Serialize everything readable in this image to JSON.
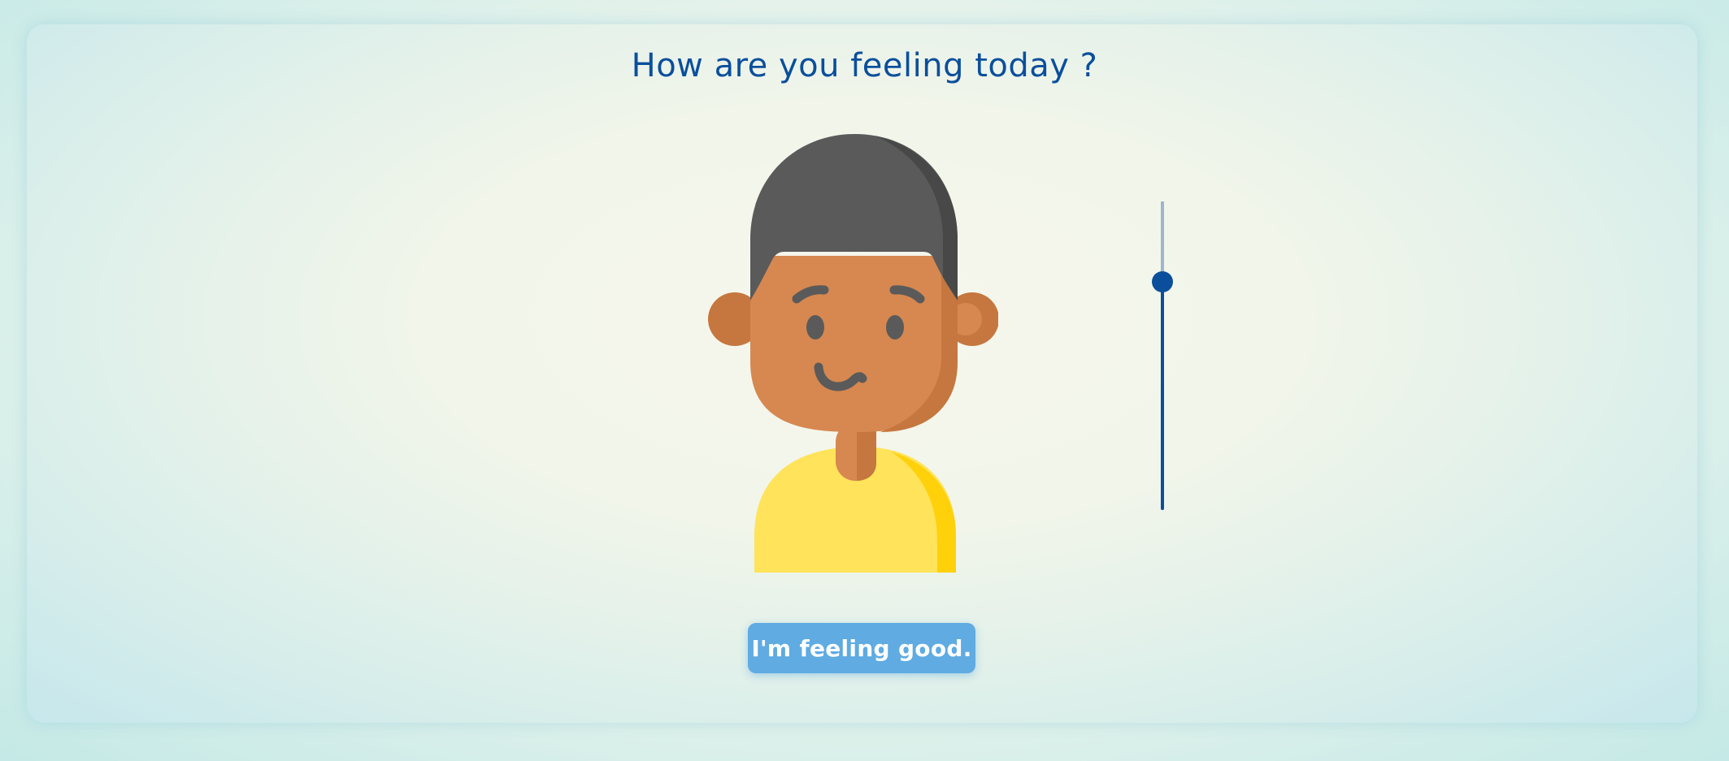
{
  "page": {
    "title": "How are you feeling today ?"
  },
  "avatar": {
    "icon": "smiling-face-avatar-icon",
    "mood": "good"
  },
  "mood_slider": {
    "value_fraction": 0.26,
    "colors": {
      "filled": "#0b4f9c",
      "unfilled": "#9cb7cf",
      "thumb": "#0b4f9c"
    }
  },
  "feeling_button": {
    "label": "I'm feeling good."
  },
  "colors": {
    "title": "#0b4f9c",
    "button_bg": "#5fabe2",
    "button_text": "#ffffff",
    "hair": "#5a5a5a",
    "skin": "#d68850",
    "shirt": "#ffe35a"
  }
}
